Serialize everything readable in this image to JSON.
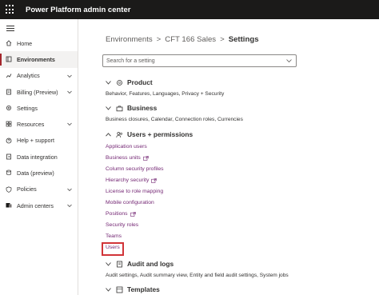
{
  "app": {
    "title": "Power Platform admin center"
  },
  "sidebar": {
    "items": [
      {
        "label": "Home",
        "icon": "home-icon",
        "chevron": false,
        "active": false
      },
      {
        "label": "Environments",
        "icon": "environments-icon",
        "chevron": false,
        "active": true
      },
      {
        "label": "Analytics",
        "icon": "analytics-icon",
        "chevron": true,
        "active": false
      },
      {
        "label": "Billing (Preview)",
        "icon": "billing-icon",
        "chevron": true,
        "active": false
      },
      {
        "label": "Settings",
        "icon": "gear-icon",
        "chevron": false,
        "active": false
      },
      {
        "label": "Resources",
        "icon": "resources-icon",
        "chevron": true,
        "active": false
      },
      {
        "label": "Help + support",
        "icon": "help-icon",
        "chevron": false,
        "active": false
      },
      {
        "label": "Data integration",
        "icon": "data-integration-icon",
        "chevron": false,
        "active": false
      },
      {
        "label": "Data (preview)",
        "icon": "database-icon",
        "chevron": false,
        "active": false
      },
      {
        "label": "Policies",
        "icon": "policies-icon",
        "chevron": true,
        "active": false
      },
      {
        "label": "Admin centers",
        "icon": "admin-centers-icon",
        "chevron": true,
        "active": false
      }
    ]
  },
  "breadcrumb": {
    "items": [
      "Environments",
      "CFT 166 Sales",
      "Settings"
    ],
    "separator": ">"
  },
  "search": {
    "placeholder": "Search for a setting"
  },
  "sections": {
    "product": {
      "label": "Product",
      "desc": "Behavior, Features, Languages, Privacy + Security"
    },
    "business": {
      "label": "Business",
      "desc": "Business closures, Calendar, Connection roles, Currencies"
    },
    "users": {
      "label": "Users + permissions"
    },
    "audit": {
      "label": "Audit and logs",
      "desc": "Audit settings, Audit summary view, Entity and field audit settings, System jobs"
    },
    "templates": {
      "label": "Templates"
    }
  },
  "user_links": [
    {
      "label": "Application users",
      "external": false
    },
    {
      "label": "Business units",
      "external": true
    },
    {
      "label": "Column security profiles",
      "external": false
    },
    {
      "label": "Hierarchy security",
      "external": true
    },
    {
      "label": "License to role mapping",
      "external": false
    },
    {
      "label": "Mobile configuration",
      "external": false
    },
    {
      "label": "Positions",
      "external": true
    },
    {
      "label": "Security roles",
      "external": false
    },
    {
      "label": "Teams",
      "external": false
    },
    {
      "label": "Users",
      "external": false,
      "highlighted": true
    }
  ],
  "colors": {
    "topbar": "#1b1a19",
    "link": "#742774",
    "highlight": "#d13438",
    "active_indicator": "#a4262c"
  }
}
